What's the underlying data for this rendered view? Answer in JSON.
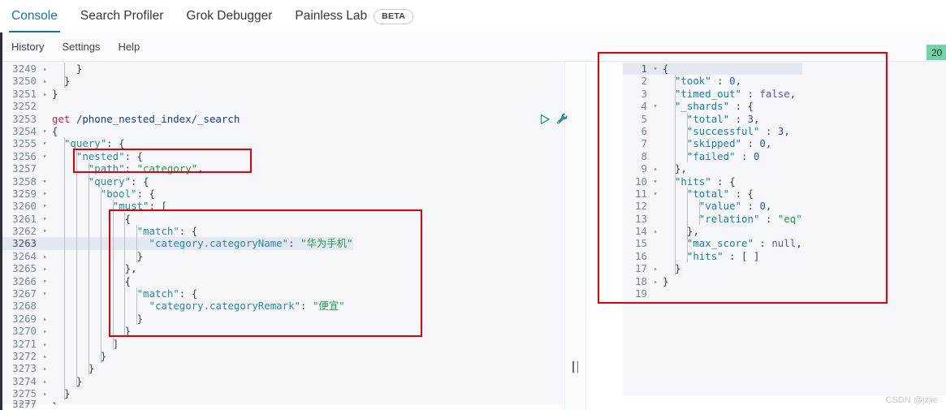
{
  "tabs": [
    {
      "label": "Console",
      "active": true
    },
    {
      "label": "Search Profiler",
      "active": false
    },
    {
      "label": "Grok Debugger",
      "active": false
    },
    {
      "label": "Painless Lab",
      "active": false,
      "badge": "BETA"
    }
  ],
  "subnav": [
    {
      "label": "History"
    },
    {
      "label": "Settings"
    },
    {
      "label": "Help"
    }
  ],
  "request_actions": {
    "play": "play-icon",
    "wrench": "wrench-icon"
  },
  "status_badge": {
    "text": "20",
    "color": "#6fd4ac"
  },
  "watermark": "CSDN @jzjie",
  "editor": {
    "first_line_number": 3249,
    "highlighted_line": 3263,
    "cut_line_number": 3277,
    "lines": [
      {
        "n": 3249,
        "fold": "up",
        "indent": 2,
        "text": "}"
      },
      {
        "n": 3250,
        "fold": "up",
        "indent": 1,
        "text": "}"
      },
      {
        "n": 3251,
        "fold": "up",
        "indent": 0,
        "text": "}"
      },
      {
        "n": 3252,
        "fold": "",
        "indent": 0,
        "text": ""
      },
      {
        "n": 3253,
        "fold": "",
        "indent": 0,
        "text": "get /phone_nested_index/_search"
      },
      {
        "n": 3254,
        "fold": "down",
        "indent": 0,
        "text": "{"
      },
      {
        "n": 3255,
        "fold": "down",
        "indent": 1,
        "text": "\"query\": {"
      },
      {
        "n": 3256,
        "fold": "down",
        "indent": 2,
        "text": "\"nested\": {"
      },
      {
        "n": 3257,
        "fold": "",
        "indent": 3,
        "text": "\"path\": \"category\","
      },
      {
        "n": 3258,
        "fold": "down",
        "indent": 3,
        "text": "\"query\": {"
      },
      {
        "n": 3259,
        "fold": "down",
        "indent": 4,
        "text": "\"bool\": {"
      },
      {
        "n": 3260,
        "fold": "down",
        "indent": 5,
        "text": "\"must\": ["
      },
      {
        "n": 3261,
        "fold": "down",
        "indent": 6,
        "text": "{"
      },
      {
        "n": 3262,
        "fold": "down",
        "indent": 7,
        "text": "\"match\": {"
      },
      {
        "n": 3263,
        "fold": "",
        "indent": 8,
        "text": "\"category.categoryName\": \"华为手机\""
      },
      {
        "n": 3264,
        "fold": "up",
        "indent": 7,
        "text": "}"
      },
      {
        "n": 3265,
        "fold": "up",
        "indent": 6,
        "text": "},"
      },
      {
        "n": 3266,
        "fold": "down",
        "indent": 6,
        "text": "{"
      },
      {
        "n": 3267,
        "fold": "down",
        "indent": 7,
        "text": "\"match\": {"
      },
      {
        "n": 3268,
        "fold": "",
        "indent": 8,
        "text": "\"category.categoryRemark\": \"便宜\""
      },
      {
        "n": 3269,
        "fold": "up",
        "indent": 7,
        "text": "}"
      },
      {
        "n": 3270,
        "fold": "up",
        "indent": 6,
        "text": "}"
      },
      {
        "n": 3271,
        "fold": "up",
        "indent": 5,
        "text": "]"
      },
      {
        "n": 3272,
        "fold": "up",
        "indent": 4,
        "text": "}"
      },
      {
        "n": 3273,
        "fold": "up",
        "indent": 3,
        "text": "}"
      },
      {
        "n": 3274,
        "fold": "up",
        "indent": 2,
        "text": "}"
      },
      {
        "n": 3275,
        "fold": "up",
        "indent": 1,
        "text": "}"
      },
      {
        "n": 3276,
        "fold": "up",
        "indent": 0,
        "text": "}"
      }
    ]
  },
  "response": {
    "highlighted_line": 1,
    "lines": [
      {
        "n": 1,
        "fold": "down",
        "indent": 0,
        "text": "{"
      },
      {
        "n": 2,
        "fold": "",
        "indent": 1,
        "text": "\"took\" : 0,"
      },
      {
        "n": 3,
        "fold": "",
        "indent": 1,
        "text": "\"timed_out\" : false,"
      },
      {
        "n": 4,
        "fold": "down",
        "indent": 1,
        "text": "\"_shards\" : {"
      },
      {
        "n": 5,
        "fold": "",
        "indent": 2,
        "text": "\"total\" : 3,"
      },
      {
        "n": 6,
        "fold": "",
        "indent": 2,
        "text": "\"successful\" : 3,"
      },
      {
        "n": 7,
        "fold": "",
        "indent": 2,
        "text": "\"skipped\" : 0,"
      },
      {
        "n": 8,
        "fold": "",
        "indent": 2,
        "text": "\"failed\" : 0"
      },
      {
        "n": 9,
        "fold": "up",
        "indent": 1,
        "text": "},"
      },
      {
        "n": 10,
        "fold": "down",
        "indent": 1,
        "text": "\"hits\" : {"
      },
      {
        "n": 11,
        "fold": "down",
        "indent": 2,
        "text": "\"total\" : {"
      },
      {
        "n": 12,
        "fold": "",
        "indent": 3,
        "text": "\"value\" : 0,"
      },
      {
        "n": 13,
        "fold": "",
        "indent": 3,
        "text": "\"relation\" : \"eq\""
      },
      {
        "n": 14,
        "fold": "up",
        "indent": 2,
        "text": "},"
      },
      {
        "n": 15,
        "fold": "",
        "indent": 2,
        "text": "\"max_score\" : null,"
      },
      {
        "n": 16,
        "fold": "",
        "indent": 2,
        "text": "\"hits\" : [ ]"
      },
      {
        "n": 17,
        "fold": "up",
        "indent": 1,
        "text": "}"
      },
      {
        "n": 18,
        "fold": "up",
        "indent": 0,
        "text": "}"
      },
      {
        "n": 19,
        "fold": "",
        "indent": 0,
        "text": ""
      }
    ]
  },
  "annotations": [
    {
      "name": "nested-path-highlight",
      "color": "#e60000"
    },
    {
      "name": "must-clause-highlight",
      "color": "#e60000"
    },
    {
      "name": "response-highlight",
      "color": "#e60000"
    }
  ]
}
